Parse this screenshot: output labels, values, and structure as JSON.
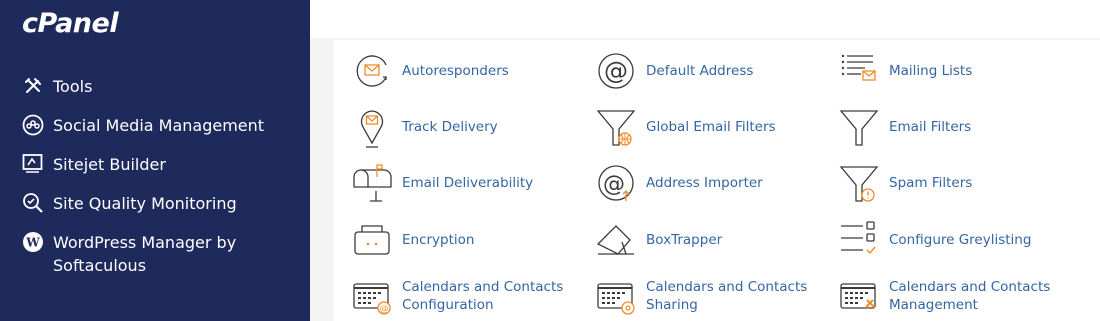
{
  "brand": {
    "logo_text": "cPanel"
  },
  "sidebar": {
    "items": [
      {
        "label": "Tools",
        "icon": "tools-icon"
      },
      {
        "label": "Social Media Management",
        "icon": "social-media-icon"
      },
      {
        "label": "Sitejet Builder",
        "icon": "sitejet-icon"
      },
      {
        "label": "Site Quality Monitoring",
        "icon": "site-quality-icon"
      },
      {
        "label": "WordPress Manager by Softaculous",
        "icon": "wordpress-icon"
      }
    ]
  },
  "email_tools": [
    {
      "label": "Autoresponders",
      "icon": "autoresponder-icon"
    },
    {
      "label": "Default Address",
      "icon": "default-address-icon"
    },
    {
      "label": "Mailing Lists",
      "icon": "mailing-list-icon"
    },
    {
      "label": "Track Delivery",
      "icon": "track-delivery-icon"
    },
    {
      "label": "Global Email Filters",
      "icon": "global-filter-icon"
    },
    {
      "label": "Email Filters",
      "icon": "email-filter-icon"
    },
    {
      "label": "Email Deliverability",
      "icon": "mailbox-icon"
    },
    {
      "label": "Address Importer",
      "icon": "address-importer-icon"
    },
    {
      "label": "Spam Filters",
      "icon": "spam-filter-icon"
    },
    {
      "label": "Encryption",
      "icon": "encryption-icon"
    },
    {
      "label": "BoxTrapper",
      "icon": "boxtrapper-icon"
    },
    {
      "label": "Configure Greylisting",
      "icon": "greylisting-icon"
    },
    {
      "label": "Calendars and Contacts Configuration",
      "icon": "calendar-config-icon"
    },
    {
      "label": "Calendars and Contacts Sharing",
      "icon": "calendar-sharing-icon"
    },
    {
      "label": "Calendars and Contacts Management",
      "icon": "calendar-management-icon"
    }
  ],
  "colors": {
    "sidebar_bg": "#1f2a5c",
    "link": "#3465a4",
    "accent": "#f28c28",
    "icon_stroke": "#3b3b3b"
  }
}
